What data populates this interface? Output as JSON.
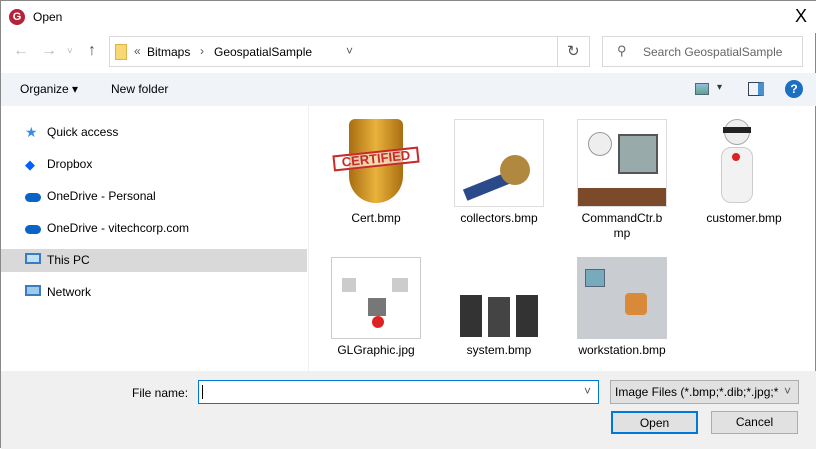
{
  "window": {
    "title": "Open",
    "close": "X",
    "app_icon_letter": "G"
  },
  "nav": {
    "back": "←",
    "forward": "→",
    "recent": "˅",
    "up": "↑",
    "breadcrumb": {
      "overflow": "«",
      "items": [
        "Bitmaps",
        "GeospatialSample"
      ],
      "separator": "›"
    },
    "refresh": "↻",
    "dropdown": "˅",
    "search_placeholder": "Search GeospatialSample"
  },
  "toolbar": {
    "organize": "Organize ▾",
    "new_folder": "New folder",
    "view": "▾",
    "help": "?"
  },
  "sidebar": {
    "items": [
      {
        "label": "Quick access",
        "icon": "star-icon"
      },
      {
        "label": "Dropbox",
        "icon": "dropbox-icon"
      },
      {
        "label": "OneDrive - Personal",
        "icon": "cloud-icon"
      },
      {
        "label": "OneDrive - vitechcorp.com",
        "icon": "cloud-icon"
      },
      {
        "label": "This PC",
        "icon": "computer-icon",
        "selected": true
      },
      {
        "label": "Network",
        "icon": "network-icon"
      }
    ]
  },
  "files": [
    {
      "name": "Cert.bmp",
      "stamp": "CERTIFIED"
    },
    {
      "name": "collectors.bmp"
    },
    {
      "name": "CommandCtr.bmp"
    },
    {
      "name": "customer.bmp"
    },
    {
      "name": "GLGraphic.jpg"
    },
    {
      "name": "system.bmp"
    },
    {
      "name": "workstation.bmp"
    }
  ],
  "bottom": {
    "file_name_label": "File name:",
    "file_name_value": "",
    "filter": "Image Files (*.bmp;*.dib;*.jpg;*",
    "open": "Open",
    "cancel": "Cancel"
  },
  "colors": {
    "accent": "#0078d7",
    "selected": "#d9d9d9",
    "help": "#1c6fc1"
  }
}
